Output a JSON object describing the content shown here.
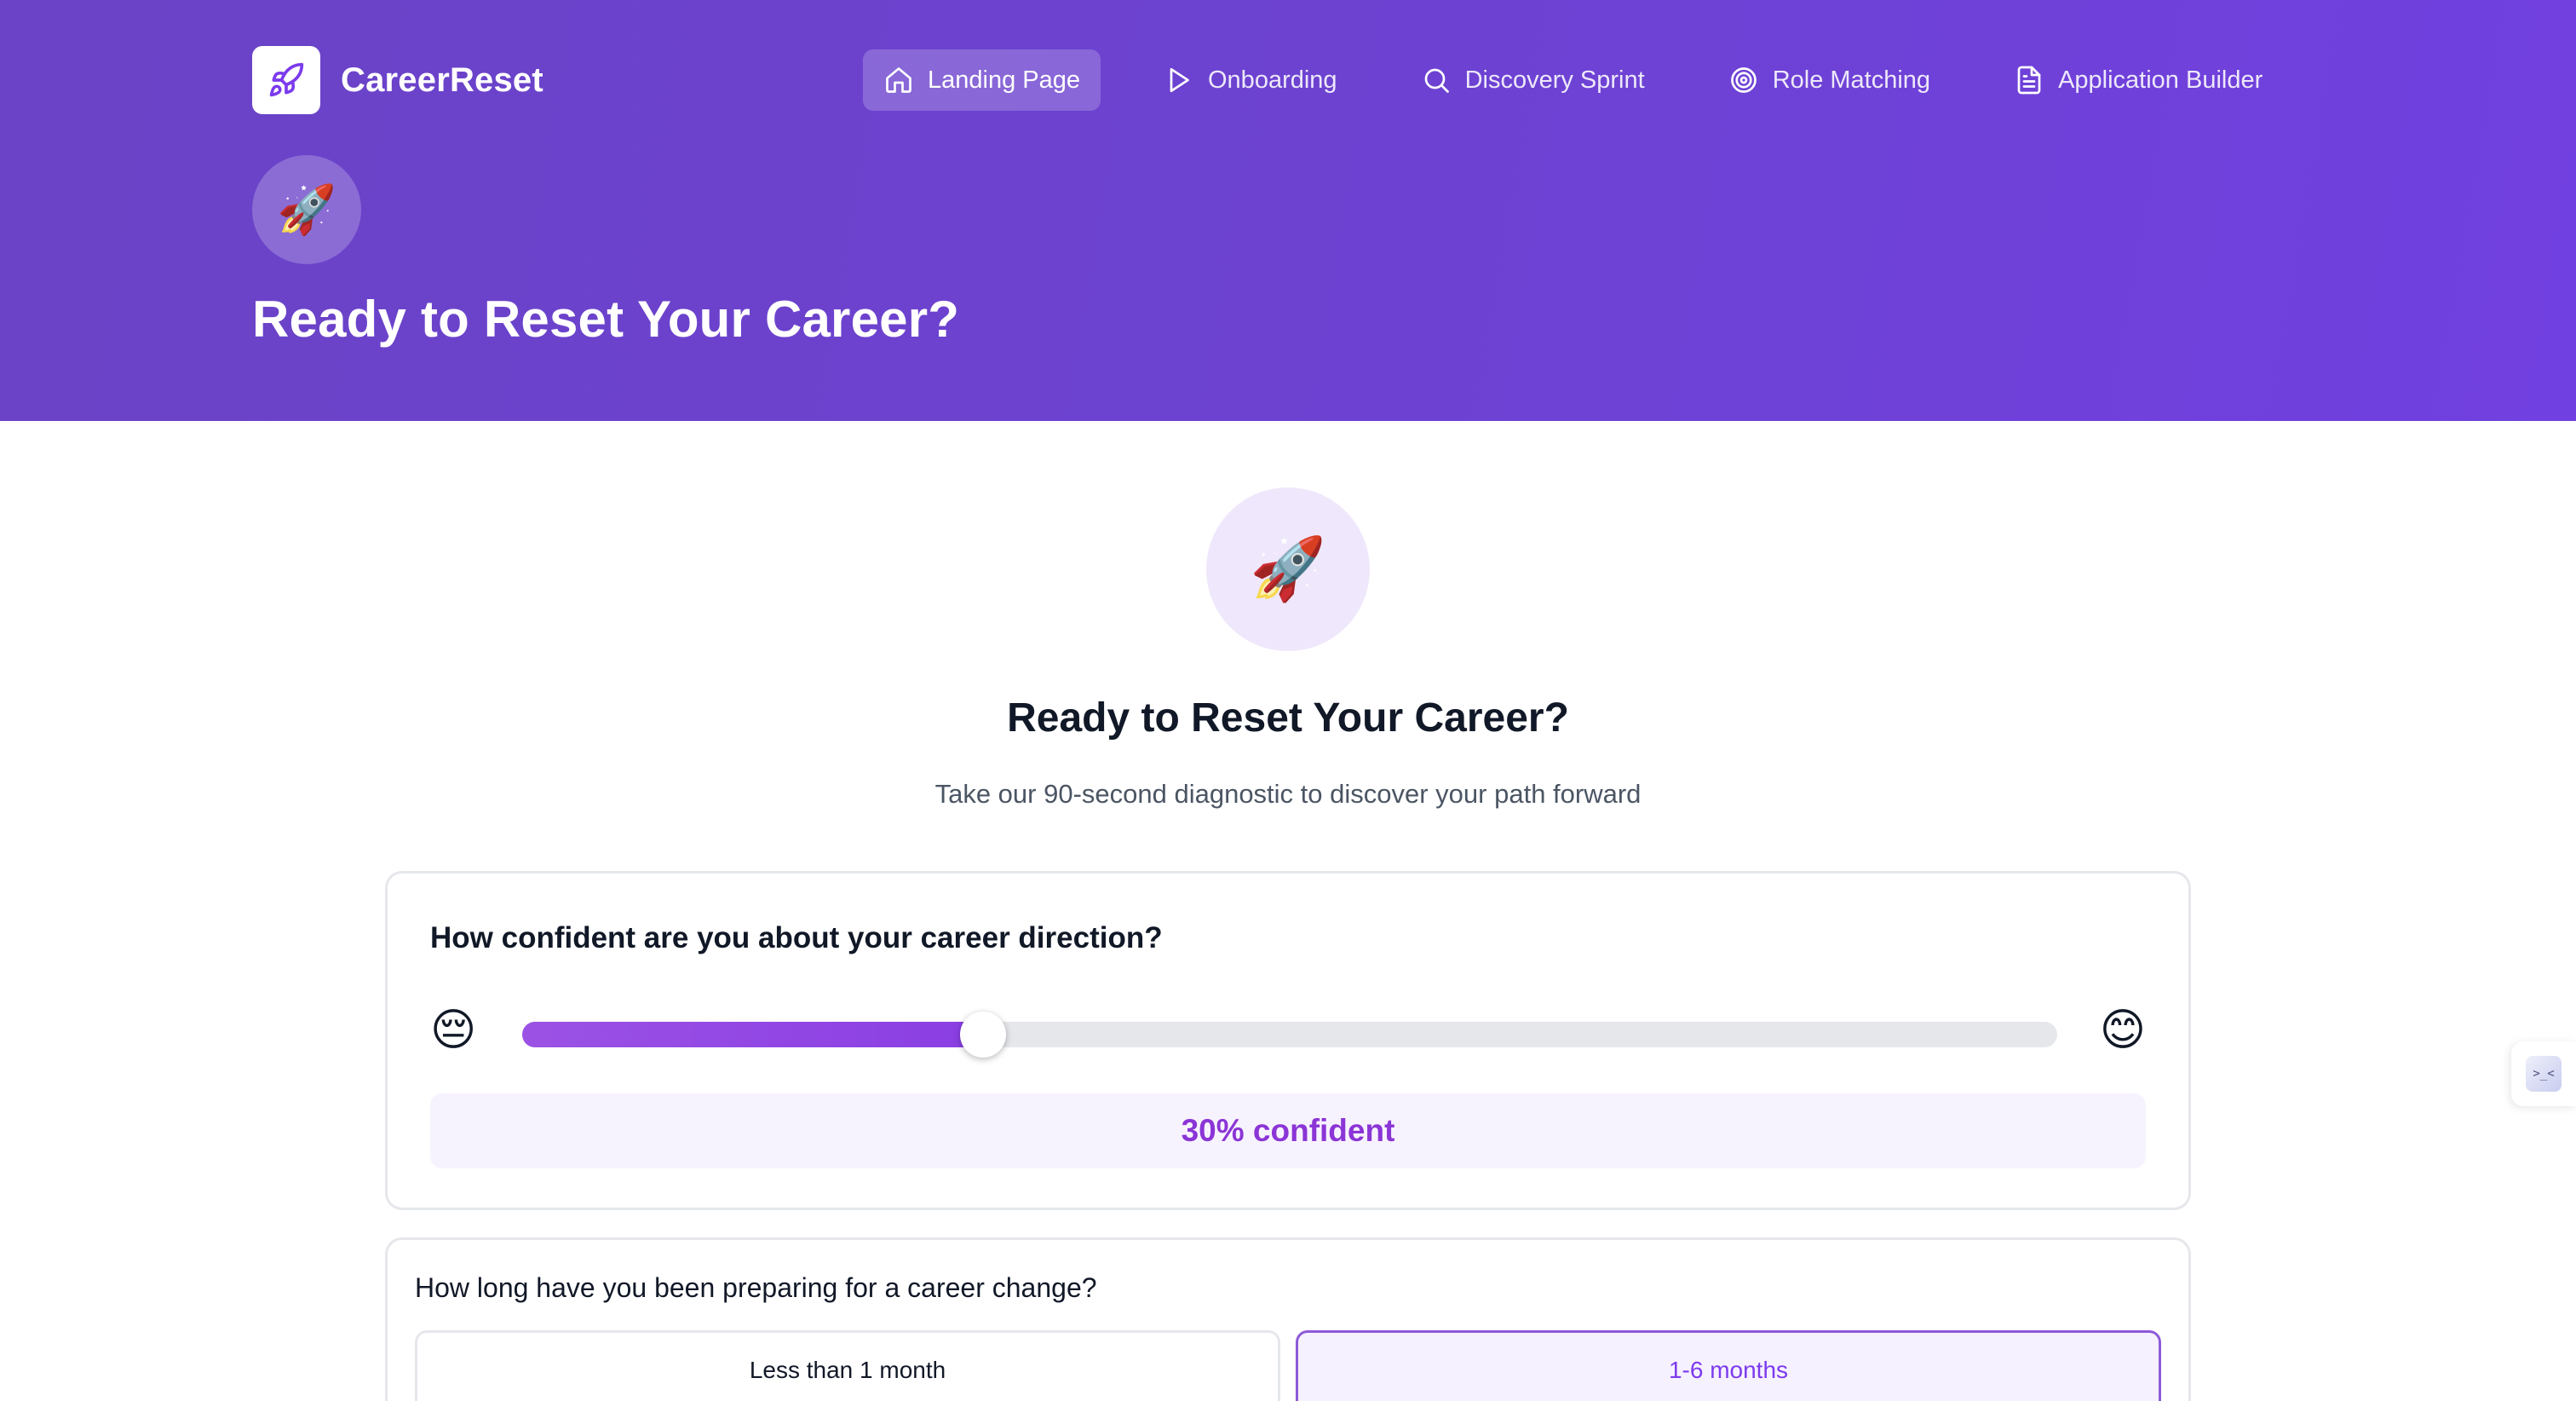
{
  "brand": {
    "name": "CareerReset",
    "logo_icon": "rocket-icon"
  },
  "nav": {
    "items": [
      {
        "label": "Landing Page",
        "icon": "home-icon",
        "active": true
      },
      {
        "label": "Onboarding",
        "icon": "play-icon",
        "active": false
      },
      {
        "label": "Discovery Sprint",
        "icon": "search-icon",
        "active": false
      },
      {
        "label": "Role Matching",
        "icon": "target-icon",
        "active": false
      },
      {
        "label": "Application Builder",
        "icon": "document-icon",
        "active": false
      }
    ]
  },
  "hero": {
    "emoji": "🚀",
    "title": "Ready to Reset Your Career?"
  },
  "main": {
    "emoji": "🚀",
    "title": "Ready to Reset Your Career?",
    "subtitle": "Take our 90-second diagnostic to discover your path forward"
  },
  "confidence": {
    "question": "How confident are you about your career direction?",
    "low_emoji": "😔",
    "high_emoji": "😊",
    "value_percent": 30,
    "result_label": "30% confident"
  },
  "preparation": {
    "question": "How long have you been preparing for a career change?",
    "options": [
      {
        "label": "Less than 1 month",
        "selected": false
      },
      {
        "label": "1-6 months",
        "selected": true
      }
    ]
  },
  "side_widget": {
    "icon": "assistant-icon",
    "glyph": ">_<"
  },
  "colors": {
    "header_gradient_start": "#6a43c6",
    "header_gradient_end": "#7140e0",
    "accent": "#8b35d6",
    "accent_fill": "#9b52e4",
    "panel_bg": "#f7f3fe"
  }
}
